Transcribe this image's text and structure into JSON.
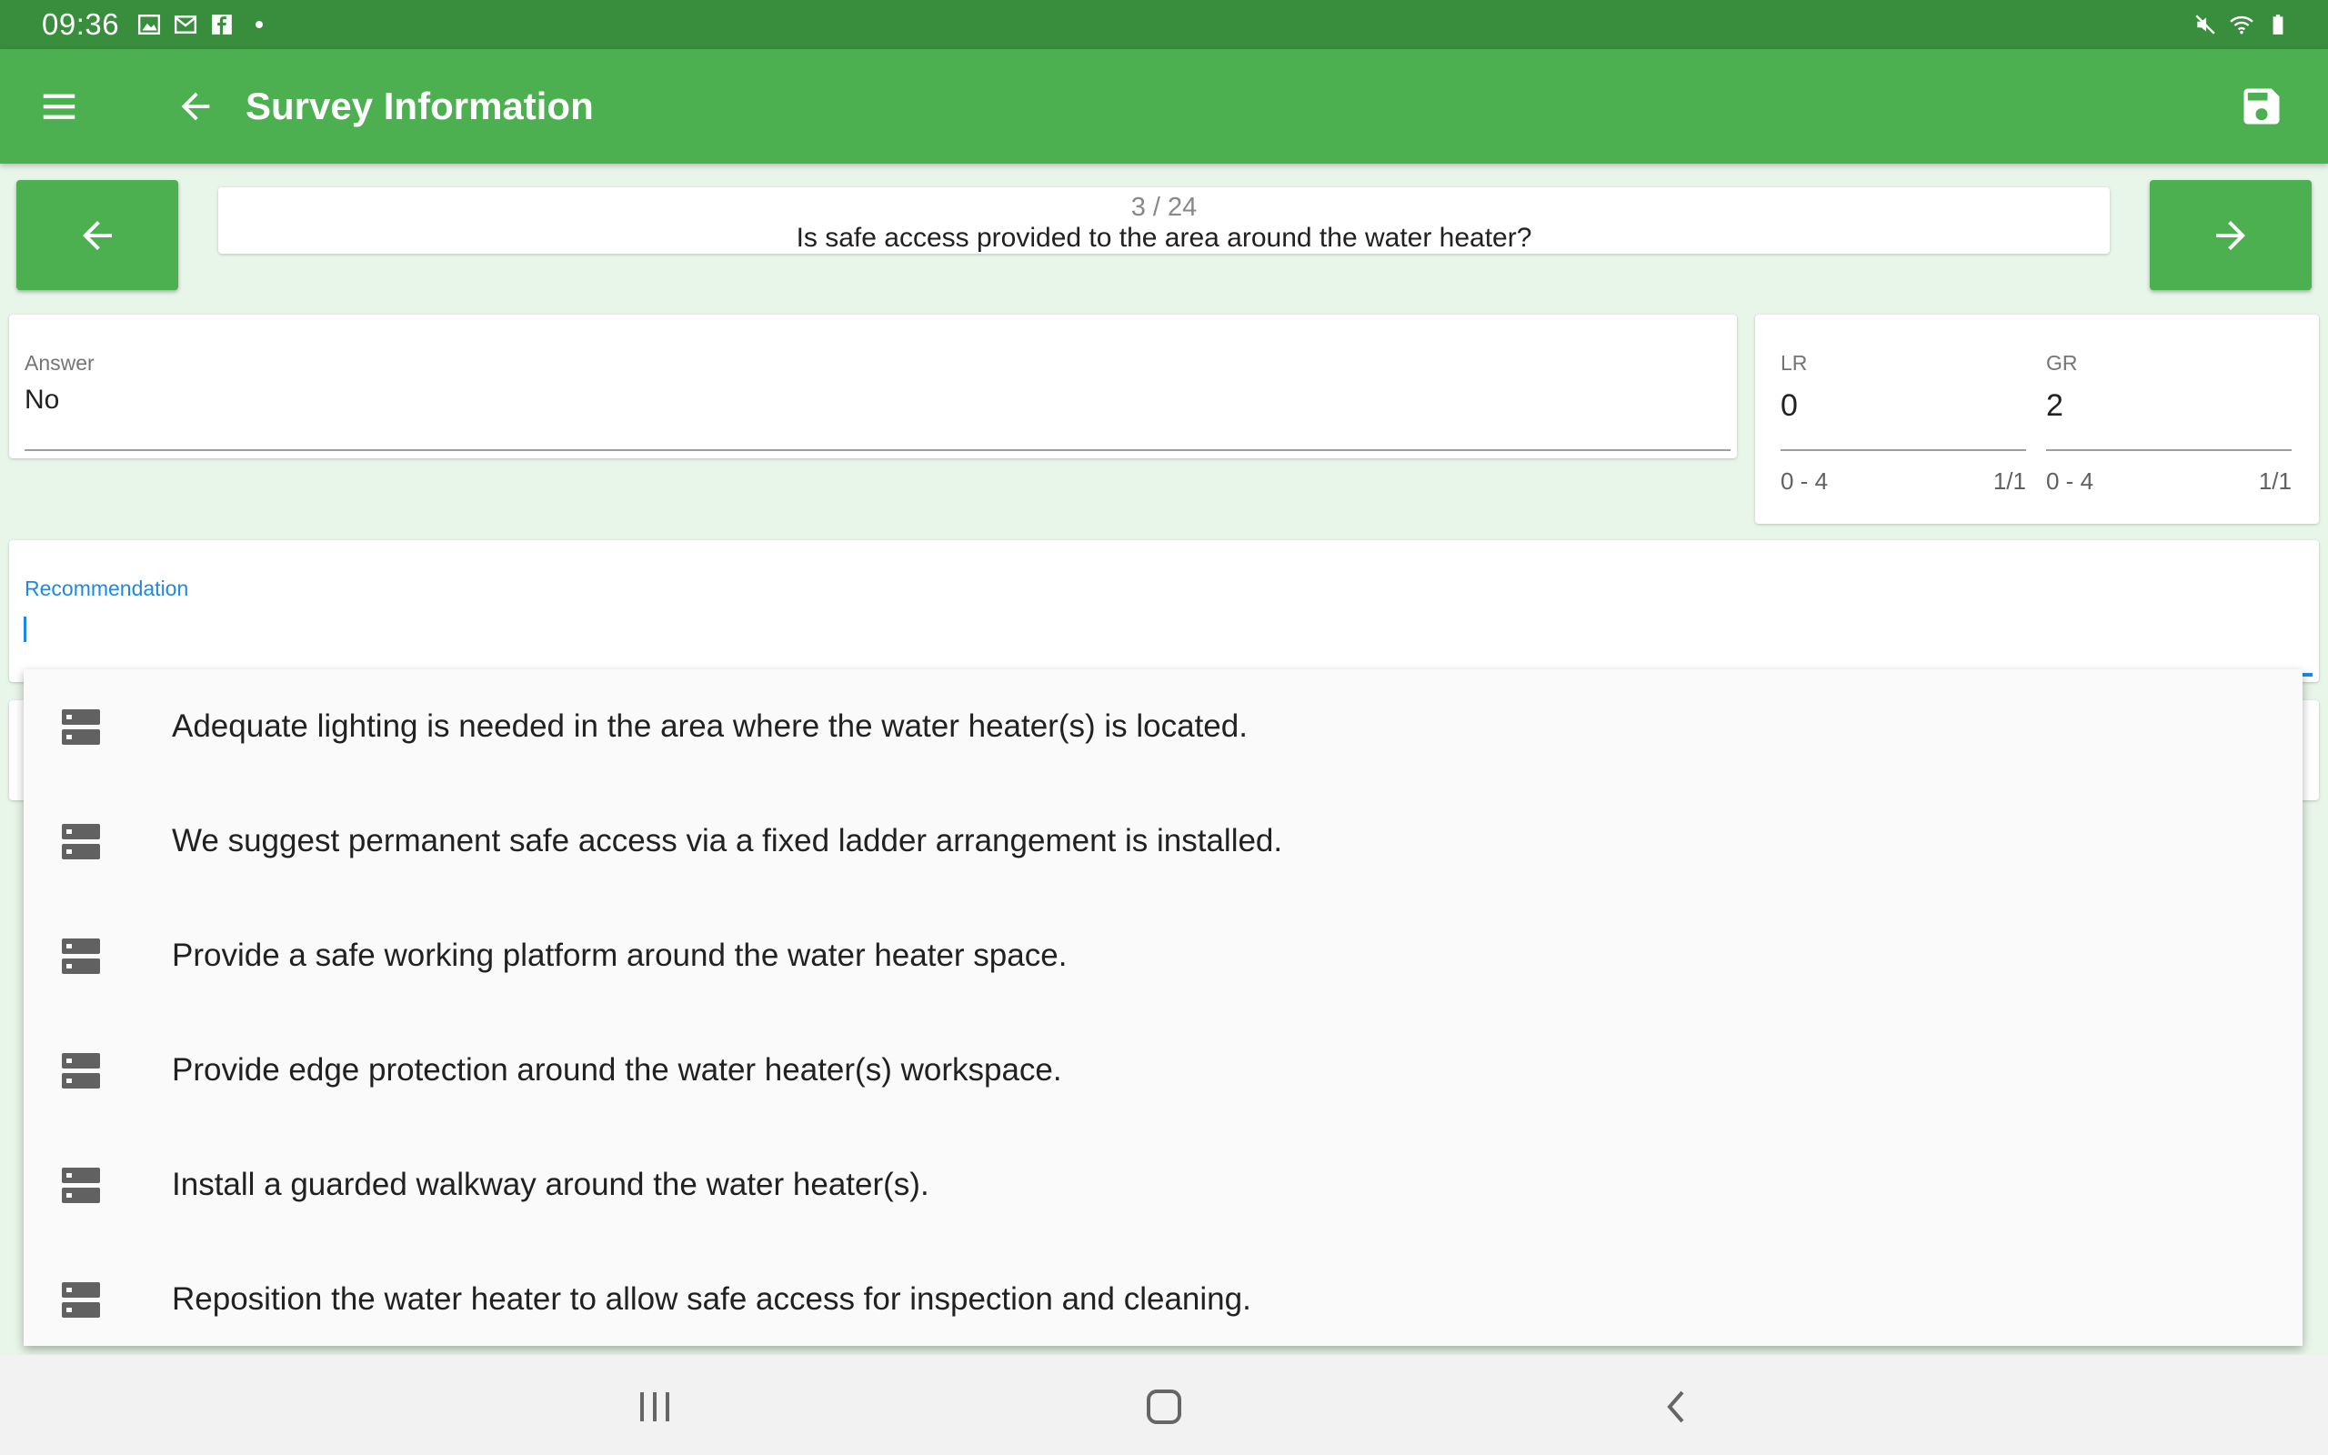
{
  "status_bar": {
    "time": "09:36",
    "left_icons": [
      "image-icon",
      "mail-icon",
      "facebook-icon",
      "dot-icon"
    ],
    "right_icons": [
      "mute-icon",
      "wifi-icon",
      "battery-icon"
    ]
  },
  "app_bar": {
    "title": "Survey Information",
    "icons": [
      "menu-icon",
      "back-arrow-icon",
      "save-icon"
    ],
    "color": "#4caf50"
  },
  "question": {
    "counter": "3 / 24",
    "text": "Is safe access provided to the area around the water heater?"
  },
  "answer": {
    "label": "Answer",
    "value": "No"
  },
  "ratings": [
    {
      "label": "LR",
      "value": "0",
      "range": "0 - 4",
      "count": "1/1"
    },
    {
      "label": "GR",
      "value": "2",
      "range": "0 - 4",
      "count": "1/1"
    }
  ],
  "recommendation": {
    "label": "Recommendation",
    "value": "",
    "accent_color": "#1e88e5"
  },
  "suggestions": [
    "Adequate lighting is needed in the area where the water heater(s) is located.",
    "We suggest permanent safe access via a fixed ladder arrangement is installed.",
    "Provide a safe working platform around the water heater space.",
    "Provide edge protection around the water heater(s) workspace.",
    "Install a guarded walkway around the water heater(s).",
    "Reposition the water heater to allow safe access for inspection and cleaning."
  ],
  "nav_bar": {
    "icons": [
      "recent-apps-icon",
      "home-icon",
      "system-back-icon"
    ]
  }
}
